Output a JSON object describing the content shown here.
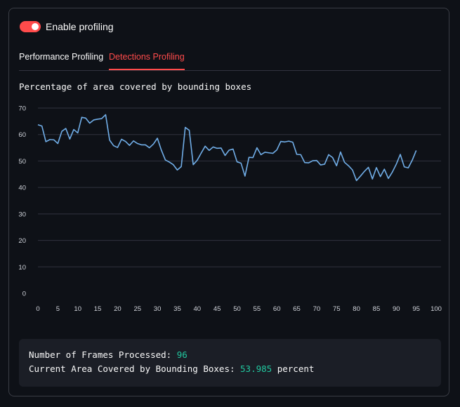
{
  "toggle": {
    "label": "Enable profiling",
    "checked": true,
    "color": "#ff4b4b"
  },
  "tabs": [
    {
      "label": "Performance Profiling",
      "active": false
    },
    {
      "label": "Detections Profiling",
      "active": true
    }
  ],
  "chart_title": "Percentage of area covered by bounding boxes",
  "info": {
    "frames_label": "Number of Frames Processed:",
    "frames_value": "96",
    "area_label": "Current Area Covered by Bounding Boxes:",
    "area_value": "53.985",
    "area_unit": "percent"
  },
  "colors": {
    "accent": "#ff4b4b",
    "line": "#71aee8",
    "number": "#21c9a0"
  },
  "chart_data": {
    "type": "line",
    "grid": true,
    "xlim": [
      0,
      100
    ],
    "ylim": [
      0,
      70
    ],
    "x_ticks": [
      0,
      5,
      10,
      15,
      20,
      25,
      30,
      35,
      40,
      45,
      50,
      55,
      60,
      65,
      70,
      75,
      80,
      85,
      90,
      95,
      100
    ],
    "y_ticks": [
      0,
      10,
      20,
      30,
      40,
      50,
      60,
      70
    ],
    "series": [
      {
        "x": [
          0,
          1,
          2,
          3,
          4,
          5,
          6,
          7,
          8,
          9,
          10,
          11,
          12,
          13,
          14,
          15,
          16,
          17,
          18,
          19,
          20,
          21,
          22,
          23,
          24,
          25,
          26,
          27,
          28,
          29,
          30,
          31,
          32,
          33,
          34,
          35,
          36,
          37,
          38,
          39,
          40,
          41,
          42,
          43,
          44,
          45,
          46,
          47,
          48,
          49,
          50,
          51,
          52,
          53,
          54,
          55,
          56,
          57,
          58,
          59,
          60,
          61,
          62,
          63,
          64,
          65,
          66,
          67,
          68,
          69,
          70,
          71,
          72,
          73,
          74,
          75,
          76,
          77,
          78,
          79,
          80,
          81,
          82,
          83,
          84,
          85,
          86,
          87,
          88,
          89,
          90,
          91,
          92,
          93,
          94,
          95
        ],
        "y": [
          63.7,
          63.2,
          57.3,
          58.1,
          58.0,
          56.6,
          61.2,
          62.3,
          58.3,
          61.9,
          60.6,
          66.5,
          66.2,
          64.3,
          65.5,
          65.8,
          66.0,
          67.5,
          57.9,
          55.8,
          55.1,
          58.2,
          57.4,
          55.9,
          57.6,
          56.6,
          56.1,
          56.1,
          55.0,
          56.4,
          58.6,
          54.1,
          50.4,
          49.6,
          48.6,
          46.6,
          47.9,
          62.7,
          61.6,
          48.6,
          50.3,
          53.0,
          55.6,
          54.0,
          55.3,
          54.8,
          54.9,
          52.1,
          54.1,
          54.5,
          49.7,
          49.2,
          44.3,
          51.4,
          51.3,
          55.0,
          52.4,
          53.3,
          53.1,
          52.9,
          54.2,
          57.4,
          57.2,
          57.5,
          57.1,
          52.5,
          52.4,
          49.4,
          49.3,
          50.1,
          50.2,
          48.5,
          48.8,
          52.4,
          51.3,
          48.2,
          53.4,
          49.5,
          48.2,
          46.6,
          42.6,
          44.3,
          46.1,
          47.6,
          43.2,
          47.5,
          44.1,
          46.9,
          43.4,
          45.8,
          48.8,
          52.5,
          47.8,
          47.4,
          50.3,
          53.985
        ]
      }
    ]
  }
}
